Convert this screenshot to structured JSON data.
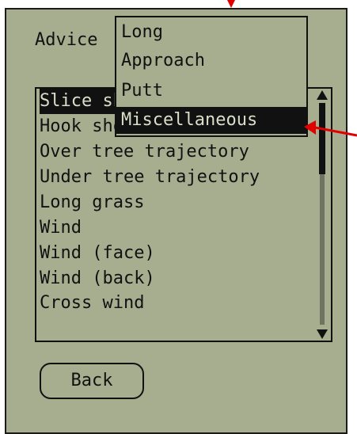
{
  "app": {
    "title_label": "Advice"
  },
  "dropdown": {
    "items": [
      {
        "label": "Long",
        "selected": false
      },
      {
        "label": "Approach",
        "selected": false
      },
      {
        "label": "Putt",
        "selected": false
      },
      {
        "label": "Miscellaneous",
        "selected": true
      }
    ]
  },
  "list": {
    "items": [
      {
        "label": "Slice shot",
        "selected": true
      },
      {
        "label": "Hook shot",
        "selected": false
      },
      {
        "label": "Over tree trajectory",
        "selected": false
      },
      {
        "label": "Under tree trajectory",
        "selected": false
      },
      {
        "label": "Long grass",
        "selected": false
      },
      {
        "label": "Wind",
        "selected": false
      },
      {
        "label": "Wind (face)",
        "selected": false
      },
      {
        "label": "Wind (back)",
        "selected": false
      },
      {
        "label": "Cross wind",
        "selected": false
      }
    ]
  },
  "buttons": {
    "back_label": "Back"
  },
  "colors": {
    "screen_bg": "#a7ae8f",
    "ink": "#111111",
    "highlight_text": "#d9dec8",
    "annotation_arrow": "#e00000"
  },
  "icons": {
    "scroll_up": "triangle-up-icon",
    "scroll_down": "triangle-down-icon",
    "annotation": "red-arrow-icon"
  }
}
